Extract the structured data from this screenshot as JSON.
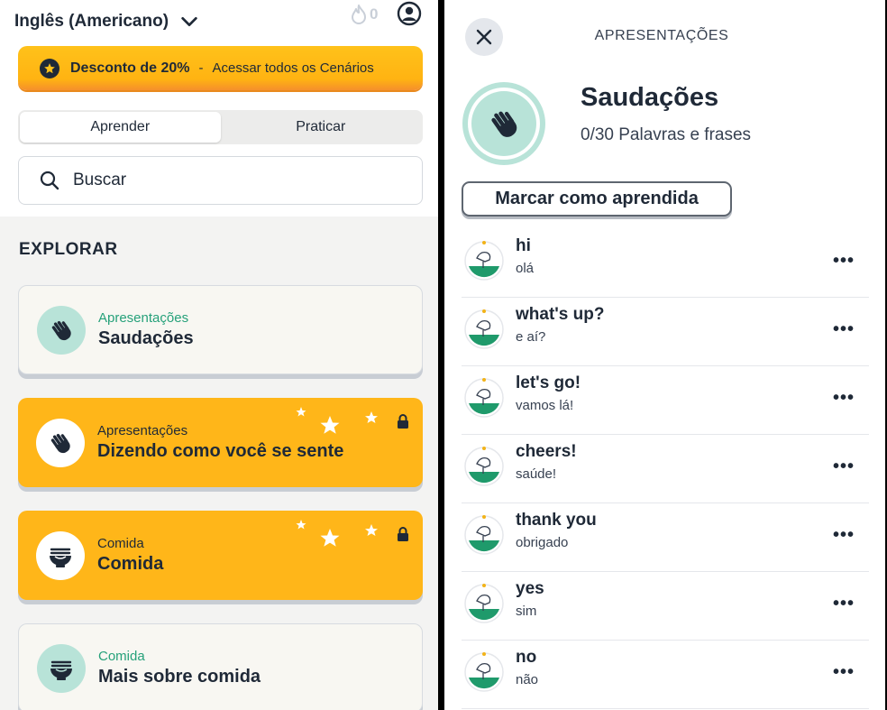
{
  "left": {
    "language_selector": "Inglês (Americano)",
    "streak_count": "0",
    "promo": {
      "highlight": "Desconto de 20%",
      "separator": "-",
      "text": "Acessar todos os Cenários"
    },
    "tabs": [
      {
        "label": "Aprender",
        "active": true
      },
      {
        "label": "Praticar",
        "active": false
      }
    ],
    "search_placeholder": "Buscar",
    "section_title": "EXPLORAR",
    "cards": [
      {
        "category": "Apresentações",
        "title": "Saudações",
        "style": "white",
        "icon": "waving-hand-icon",
        "locked": false
      },
      {
        "category": "Apresentações",
        "title": "Dizendo como você se sente",
        "style": "orange",
        "icon": "waving-hand-icon",
        "locked": true
      },
      {
        "category": "Comida",
        "title": "Comida",
        "style": "orange",
        "icon": "noodle-bowl-icon",
        "locked": true
      },
      {
        "category": "Comida",
        "title": "Mais sobre comida",
        "style": "white",
        "icon": "noodle-bowl-icon",
        "locked": false
      }
    ]
  },
  "right": {
    "header": "APRESENTAÇÕES",
    "title": "Saudações",
    "progress_text": "0/30 Palavras e frases",
    "mark_button": "Marcar como aprendida",
    "phrases": [
      {
        "word": "hi",
        "translation": "olá"
      },
      {
        "word": "what's up?",
        "translation": "e aí?"
      },
      {
        "word": "let's go!",
        "translation": "vamos lá!"
      },
      {
        "word": "cheers!",
        "translation": "saúde!"
      },
      {
        "word": "thank you",
        "translation": "obrigado"
      },
      {
        "word": "yes",
        "translation": "sim"
      },
      {
        "word": "no",
        "translation": "não"
      }
    ],
    "more_label": "•••"
  },
  "colors": {
    "accent_orange": "#ffb619",
    "accent_teal": "#b8e3d8",
    "category_green": "#26a17a"
  }
}
